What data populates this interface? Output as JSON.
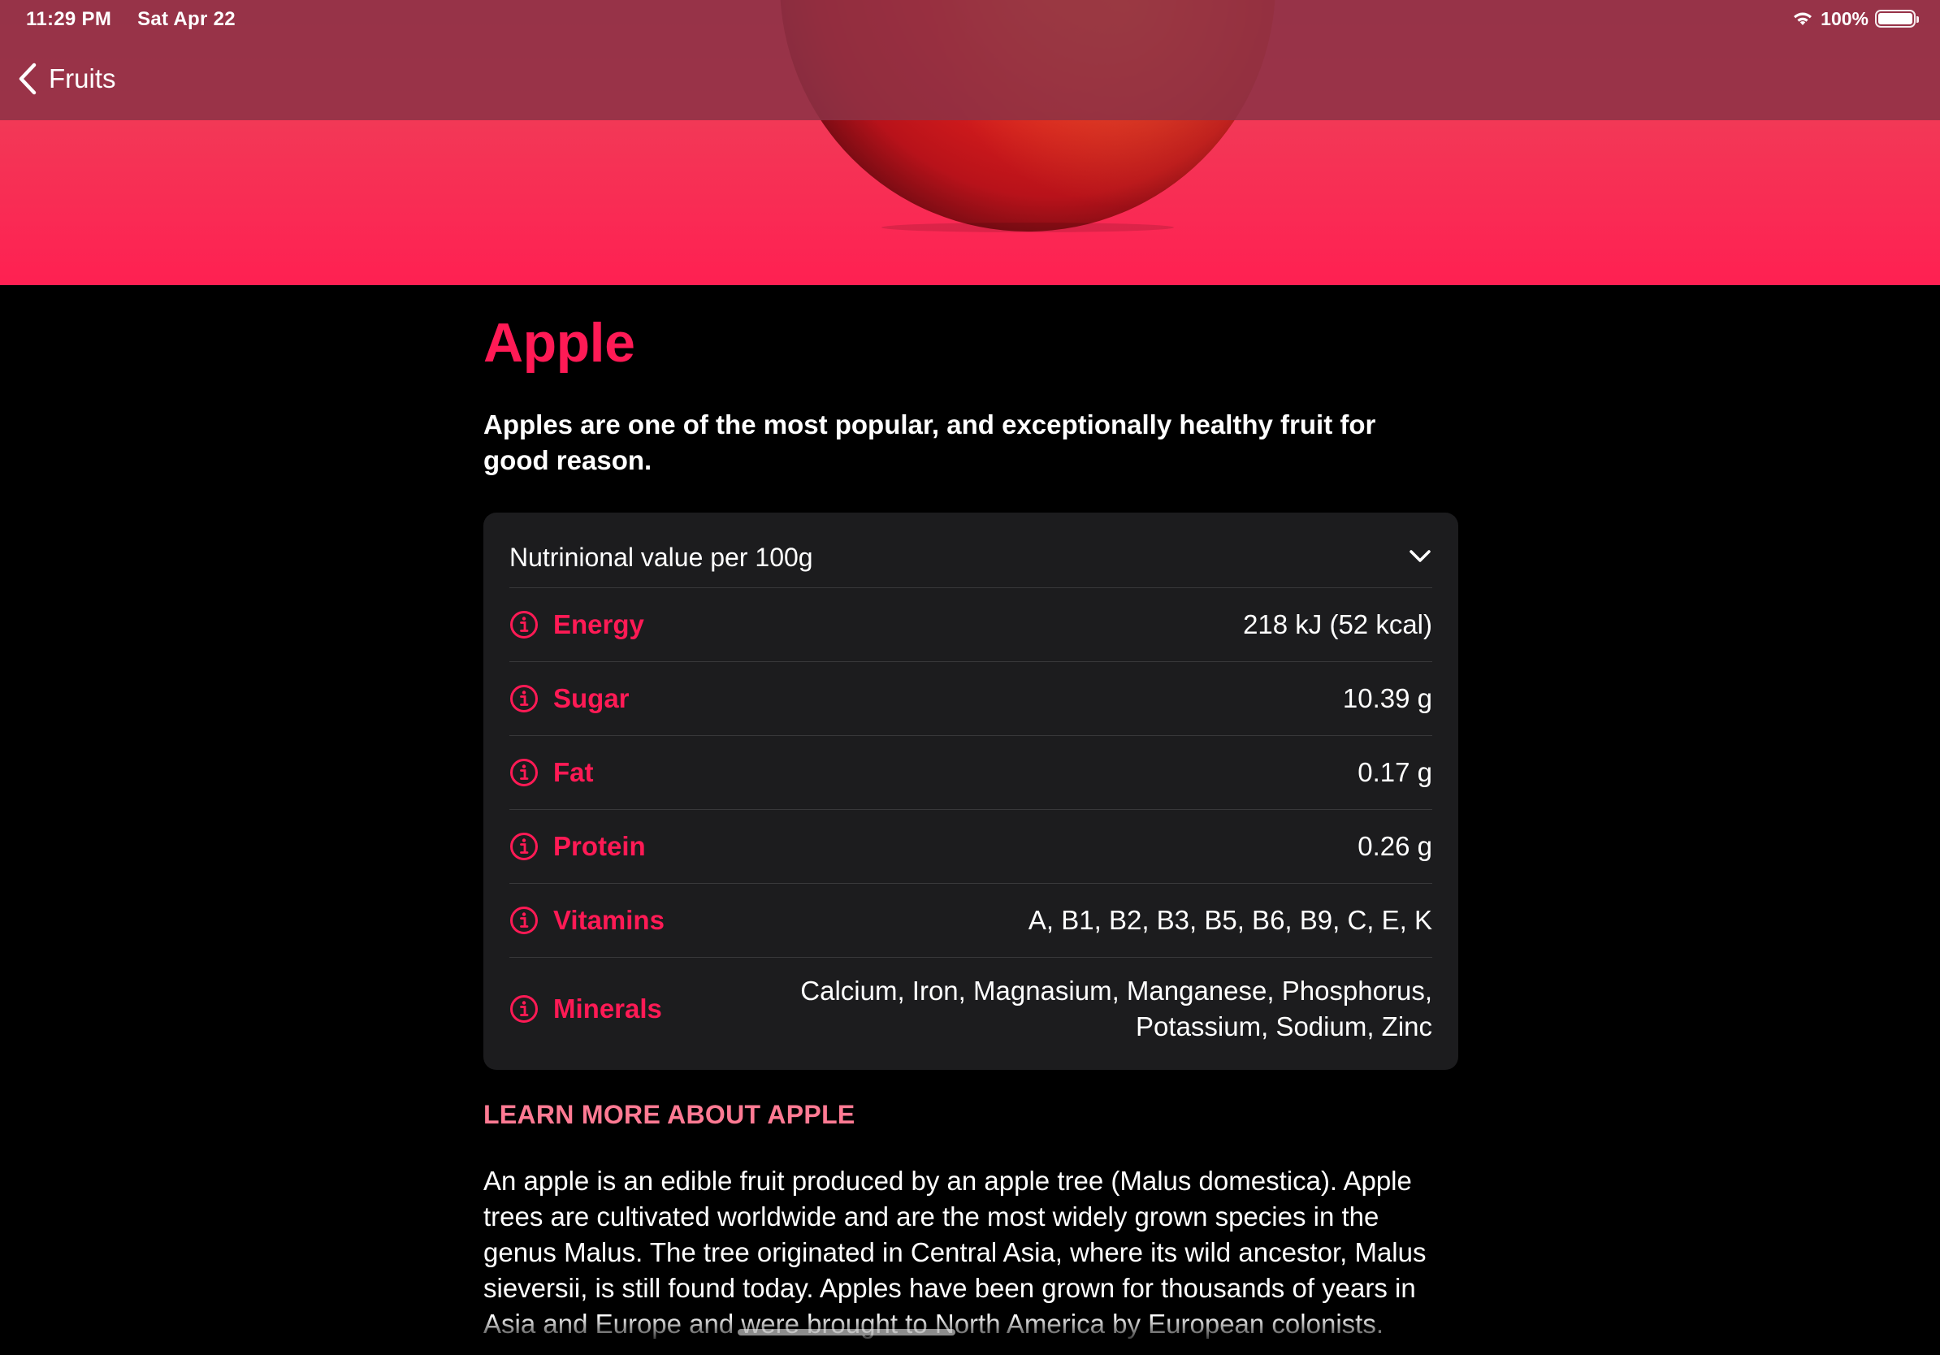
{
  "status_bar": {
    "time": "11:29 PM",
    "date": "Sat Apr 22",
    "battery": "100%",
    "icons": [
      "wifi-icon",
      "battery-icon"
    ]
  },
  "nav": {
    "back_label": "Fruits",
    "back_icon": "chevron-left-icon"
  },
  "colors": {
    "accent": "#ff1a55",
    "hero": "#ff2052",
    "section_header": "#ff7a93",
    "card_bg": "#1c1c1e",
    "background": "#000000"
  },
  "fruit": {
    "title": "Apple",
    "subtitle": "Apples are one of the most popular, and exceptionally healthy fruit for good reason."
  },
  "nutrition": {
    "header": "Nutrinional value per 100g",
    "expand_icon": "chevron-down-icon",
    "rows": [
      {
        "name": "Energy",
        "value": "218 kJ (52 kcal)",
        "icon": "info-icon"
      },
      {
        "name": "Sugar",
        "value": "10.39 g",
        "icon": "info-icon"
      },
      {
        "name": "Fat",
        "value": "0.17 g",
        "icon": "info-icon"
      },
      {
        "name": "Protein",
        "value": "0.26 g",
        "icon": "info-icon"
      },
      {
        "name": "Vitamins",
        "value": "A, B1, B2, B3, B5, B6, B9, C, E, K",
        "icon": "info-icon"
      },
      {
        "name": "Minerals",
        "value": "Calcium, Iron, Magnasium, Manganese, Phosphorus,\nPotassium, Sodium, Zinc",
        "icon": "info-icon"
      }
    ]
  },
  "learn_more": {
    "header": "LEARN MORE ABOUT APPLE",
    "body": "An apple is an edible fruit produced by an apple tree (Malus domestica). Apple trees are cultivated worldwide and are the most widely grown species in the genus Malus. The tree originated in Central Asia, where its wild ancestor, Malus sieversii, is still found today. Apples have been grown for thousands of years in Asia and Europe and were brought to North America by European colonists."
  }
}
